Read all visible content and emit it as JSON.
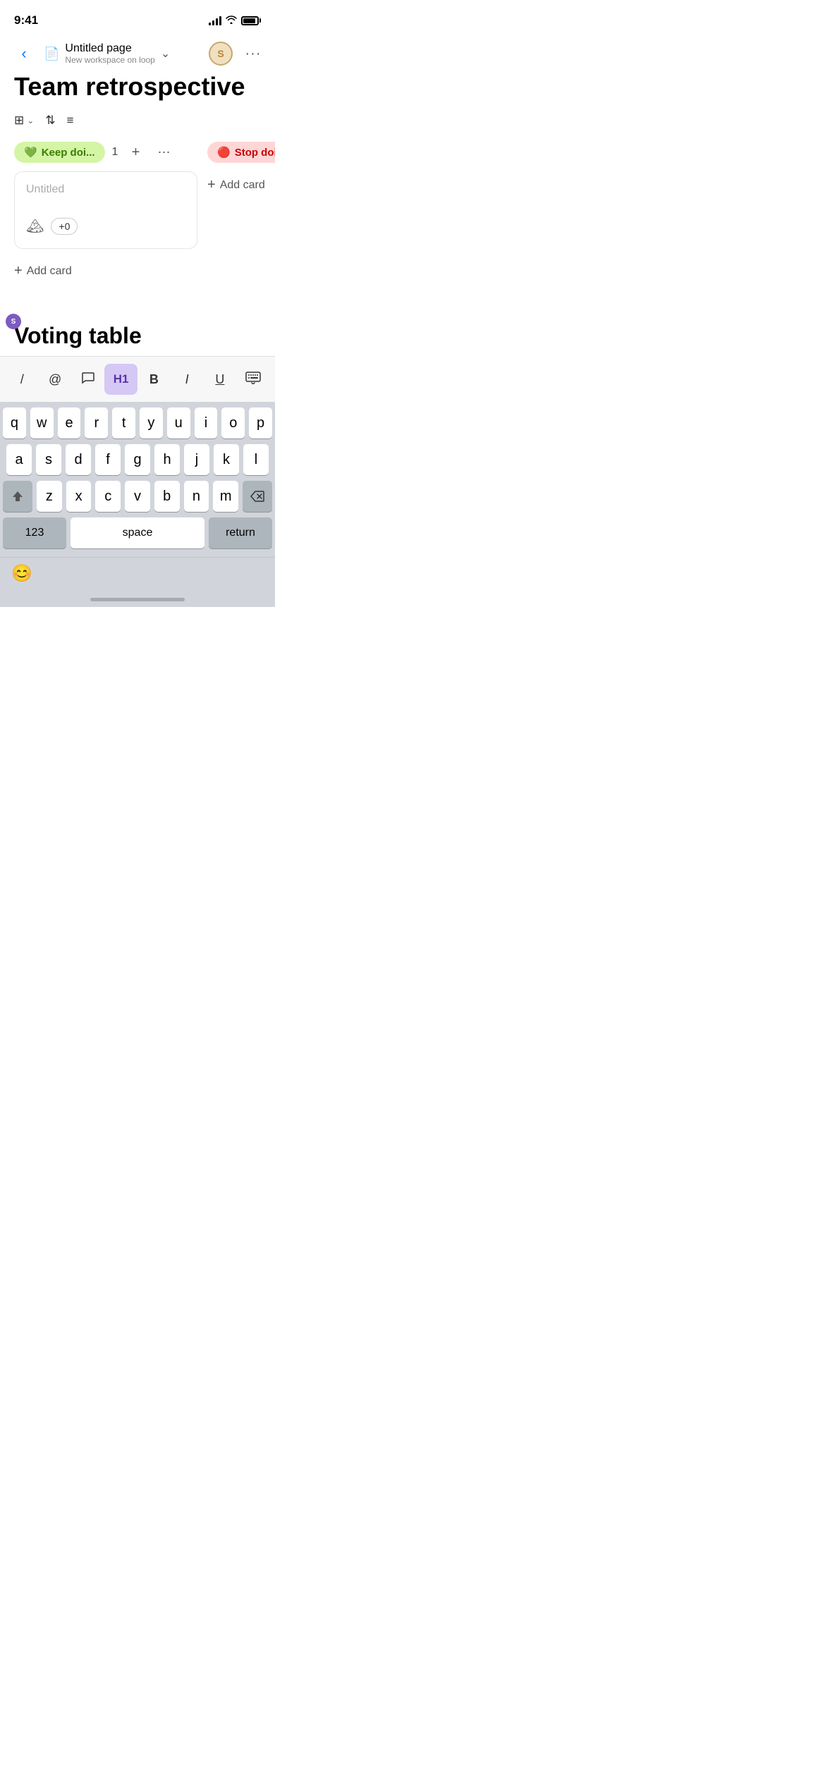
{
  "statusBar": {
    "time": "9:41",
    "avatarLabel": "S"
  },
  "navBar": {
    "pageIcon": "📄",
    "title": "Untitled page",
    "subtitle": "New workspace on loop",
    "backLabel": "‹",
    "dropdownArrow": "∨",
    "moreLabel": "···"
  },
  "pageTitle": "Team retrospective",
  "toolbar": {
    "viewIcon": "⊞",
    "sortIcon": "⇅",
    "filterIcon": "≡"
  },
  "columns": [
    {
      "id": "keep",
      "emoji": "💚",
      "label": "Keep doi...",
      "tagClass": "green",
      "count": "1",
      "cards": [
        {
          "title": "Untitled",
          "voteLabel": "+0"
        }
      ],
      "addCardLabel": "Add card"
    },
    {
      "id": "stop",
      "emoji": "🔴",
      "label": "Stop doin",
      "tagClass": "red",
      "count": "",
      "cards": [],
      "addCardLabel": "Add card"
    }
  ],
  "sectionTitle": "Voting table",
  "formattingToolbar": {
    "slashLabel": "/",
    "atLabel": "@",
    "commentLabel": "💬",
    "h1Label": "H1",
    "boldLabel": "B",
    "italicLabel": "I",
    "underlineLabel": "U",
    "keyboardLabel": "⌨"
  },
  "keyboard": {
    "rows": [
      [
        "q",
        "w",
        "e",
        "r",
        "t",
        "y",
        "u",
        "i",
        "o",
        "p"
      ],
      [
        "a",
        "s",
        "d",
        "f",
        "g",
        "h",
        "j",
        "k",
        "l"
      ],
      [
        "z",
        "x",
        "c",
        "v",
        "b",
        "n",
        "m"
      ]
    ],
    "spaceLabel": "space",
    "returnLabel": "return",
    "numbersLabel": "123"
  },
  "emojiBar": {
    "emoji": "😊"
  },
  "userCursor": {
    "label": "S"
  },
  "colors": {
    "accent": "#7c5cbf",
    "green": "#d4f5a5",
    "red": "#ffd6d6",
    "keyBackground": "#d1d5db"
  }
}
